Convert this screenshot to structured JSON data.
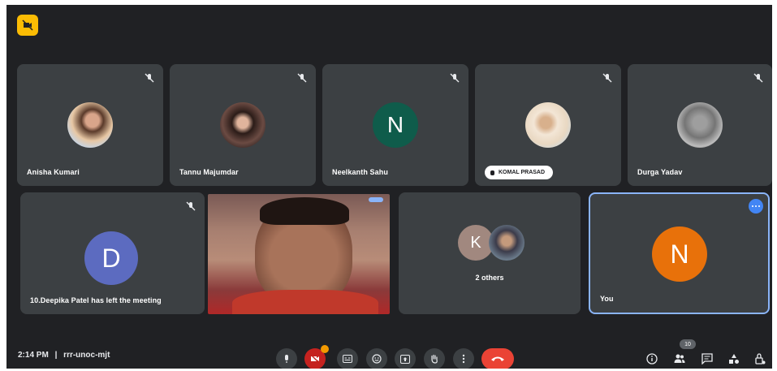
{
  "meeting": {
    "time": "2:14 PM",
    "separator": "|",
    "code": "rrr-unoc-mjt",
    "participant_count": "10"
  },
  "tiles": {
    "anisha": {
      "name": "Anisha Kumari"
    },
    "tannu": {
      "name": "Tannu Majumdar"
    },
    "neelkanth": {
      "name": "Neelkanth Sahu",
      "initial": "N"
    },
    "komal": {
      "name": "KOMAL PRASAD"
    },
    "durga": {
      "name": "Durga Yadav"
    },
    "deepika": {
      "name": "10.Deepika Patel has left the meeting",
      "initial": "D"
    },
    "others": {
      "name": "2 others",
      "initial": "K"
    },
    "you": {
      "name": "You",
      "initial": "N"
    }
  },
  "colors": {
    "background": "#202124",
    "tile": "#3c4043",
    "neelkanth_avatar": "#0f5c4b",
    "deepika_avatar": "#5c6bc0",
    "others_avatar": "#a1887f",
    "you_avatar": "#e8710a",
    "end_call": "#ea4335",
    "active_speaker_border": "#8ab4f8",
    "top_badge": "#fbbc04"
  },
  "icons": {
    "top": "camera-off-icon",
    "mute": "mic-off-icon",
    "controls": [
      "mic-icon",
      "camera-off-icon",
      "captions-icon",
      "emoji-icon",
      "present-icon",
      "raise-hand-icon",
      "more-options-icon",
      "end-call-icon"
    ],
    "right": [
      "info-icon",
      "people-icon",
      "chat-icon",
      "activities-icon",
      "host-controls-icon"
    ]
  }
}
